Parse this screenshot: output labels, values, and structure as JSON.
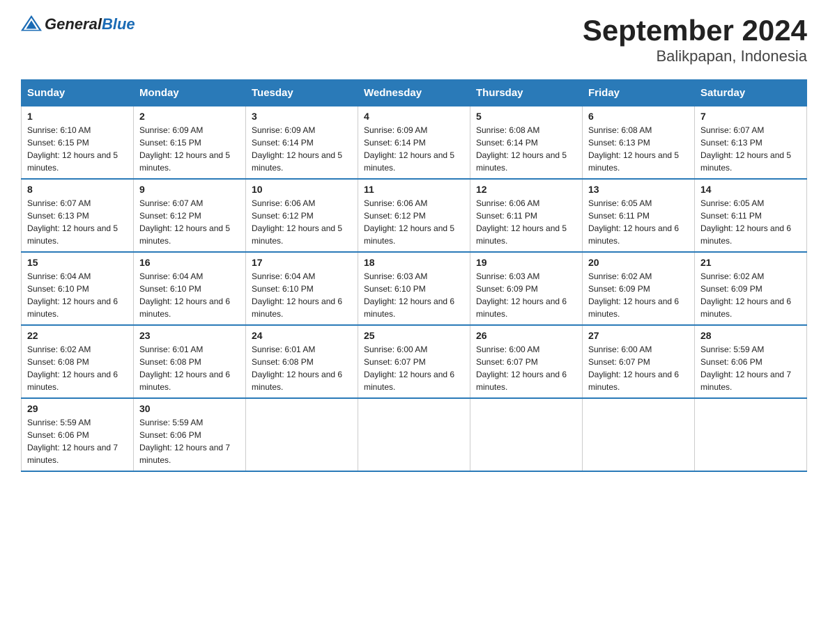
{
  "header": {
    "title": "September 2024",
    "subtitle": "Balikpapan, Indonesia",
    "logo_general": "General",
    "logo_blue": "Blue"
  },
  "columns": [
    "Sunday",
    "Monday",
    "Tuesday",
    "Wednesday",
    "Thursday",
    "Friday",
    "Saturday"
  ],
  "weeks": [
    [
      {
        "day": "1",
        "sunrise": "6:10 AM",
        "sunset": "6:15 PM",
        "daylight": "12 hours and 5 minutes."
      },
      {
        "day": "2",
        "sunrise": "6:09 AM",
        "sunset": "6:15 PM",
        "daylight": "12 hours and 5 minutes."
      },
      {
        "day": "3",
        "sunrise": "6:09 AM",
        "sunset": "6:14 PM",
        "daylight": "12 hours and 5 minutes."
      },
      {
        "day": "4",
        "sunrise": "6:09 AM",
        "sunset": "6:14 PM",
        "daylight": "12 hours and 5 minutes."
      },
      {
        "day": "5",
        "sunrise": "6:08 AM",
        "sunset": "6:14 PM",
        "daylight": "12 hours and 5 minutes."
      },
      {
        "day": "6",
        "sunrise": "6:08 AM",
        "sunset": "6:13 PM",
        "daylight": "12 hours and 5 minutes."
      },
      {
        "day": "7",
        "sunrise": "6:07 AM",
        "sunset": "6:13 PM",
        "daylight": "12 hours and 5 minutes."
      }
    ],
    [
      {
        "day": "8",
        "sunrise": "6:07 AM",
        "sunset": "6:13 PM",
        "daylight": "12 hours and 5 minutes."
      },
      {
        "day": "9",
        "sunrise": "6:07 AM",
        "sunset": "6:12 PM",
        "daylight": "12 hours and 5 minutes."
      },
      {
        "day": "10",
        "sunrise": "6:06 AM",
        "sunset": "6:12 PM",
        "daylight": "12 hours and 5 minutes."
      },
      {
        "day": "11",
        "sunrise": "6:06 AM",
        "sunset": "6:12 PM",
        "daylight": "12 hours and 5 minutes."
      },
      {
        "day": "12",
        "sunrise": "6:06 AM",
        "sunset": "6:11 PM",
        "daylight": "12 hours and 5 minutes."
      },
      {
        "day": "13",
        "sunrise": "6:05 AM",
        "sunset": "6:11 PM",
        "daylight": "12 hours and 6 minutes."
      },
      {
        "day": "14",
        "sunrise": "6:05 AM",
        "sunset": "6:11 PM",
        "daylight": "12 hours and 6 minutes."
      }
    ],
    [
      {
        "day": "15",
        "sunrise": "6:04 AM",
        "sunset": "6:10 PM",
        "daylight": "12 hours and 6 minutes."
      },
      {
        "day": "16",
        "sunrise": "6:04 AM",
        "sunset": "6:10 PM",
        "daylight": "12 hours and 6 minutes."
      },
      {
        "day": "17",
        "sunrise": "6:04 AM",
        "sunset": "6:10 PM",
        "daylight": "12 hours and 6 minutes."
      },
      {
        "day": "18",
        "sunrise": "6:03 AM",
        "sunset": "6:10 PM",
        "daylight": "12 hours and 6 minutes."
      },
      {
        "day": "19",
        "sunrise": "6:03 AM",
        "sunset": "6:09 PM",
        "daylight": "12 hours and 6 minutes."
      },
      {
        "day": "20",
        "sunrise": "6:02 AM",
        "sunset": "6:09 PM",
        "daylight": "12 hours and 6 minutes."
      },
      {
        "day": "21",
        "sunrise": "6:02 AM",
        "sunset": "6:09 PM",
        "daylight": "12 hours and 6 minutes."
      }
    ],
    [
      {
        "day": "22",
        "sunrise": "6:02 AM",
        "sunset": "6:08 PM",
        "daylight": "12 hours and 6 minutes."
      },
      {
        "day": "23",
        "sunrise": "6:01 AM",
        "sunset": "6:08 PM",
        "daylight": "12 hours and 6 minutes."
      },
      {
        "day": "24",
        "sunrise": "6:01 AM",
        "sunset": "6:08 PM",
        "daylight": "12 hours and 6 minutes."
      },
      {
        "day": "25",
        "sunrise": "6:00 AM",
        "sunset": "6:07 PM",
        "daylight": "12 hours and 6 minutes."
      },
      {
        "day": "26",
        "sunrise": "6:00 AM",
        "sunset": "6:07 PM",
        "daylight": "12 hours and 6 minutes."
      },
      {
        "day": "27",
        "sunrise": "6:00 AM",
        "sunset": "6:07 PM",
        "daylight": "12 hours and 6 minutes."
      },
      {
        "day": "28",
        "sunrise": "5:59 AM",
        "sunset": "6:06 PM",
        "daylight": "12 hours and 7 minutes."
      }
    ],
    [
      {
        "day": "29",
        "sunrise": "5:59 AM",
        "sunset": "6:06 PM",
        "daylight": "12 hours and 7 minutes."
      },
      {
        "day": "30",
        "sunrise": "5:59 AM",
        "sunset": "6:06 PM",
        "daylight": "12 hours and 7 minutes."
      },
      null,
      null,
      null,
      null,
      null
    ]
  ]
}
